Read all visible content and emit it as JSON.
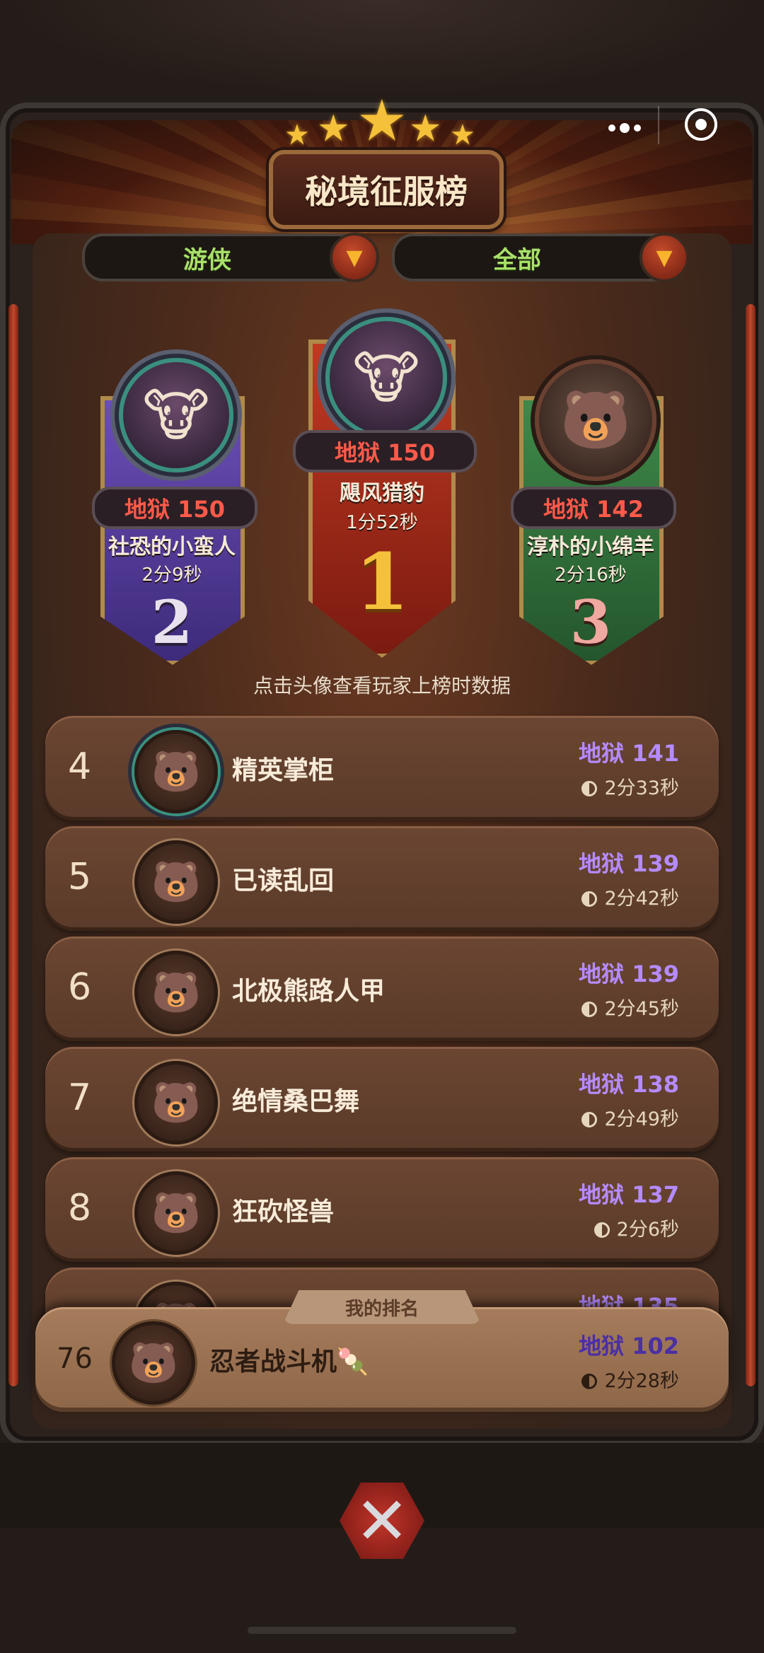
{
  "header": {
    "title": "秘境征服榜",
    "filter_class": "游侠",
    "filter_scope": "全部"
  },
  "podium": [
    {
      "rank": "1",
      "difficulty": "地狱 150",
      "name": "飓风猎豹",
      "time": "1分52秒"
    },
    {
      "rank": "2",
      "difficulty": "地狱 150",
      "name": "社恐的小蛮人",
      "time": "2分9秒"
    },
    {
      "rank": "3",
      "difficulty": "地狱 142",
      "name": "淳朴的小绵羊",
      "time": "2分16秒"
    }
  ],
  "hint": "点击头像查看玩家上榜时数据",
  "rows": [
    {
      "rank": "4",
      "name": "精英掌柜",
      "score": "地狱 141",
      "time": "2分33秒"
    },
    {
      "rank": "5",
      "name": "已读乱回",
      "score": "地狱 139",
      "time": "2分42秒"
    },
    {
      "rank": "6",
      "name": "北极熊路人甲",
      "score": "地狱 139",
      "time": "2分45秒"
    },
    {
      "rank": "7",
      "name": "绝情桑巴舞",
      "score": "地狱 138",
      "time": "2分49秒"
    },
    {
      "rank": "8",
      "name": "狂砍怪兽",
      "score": "地狱 137",
      "time": "2分6秒"
    },
    {
      "rank": "",
      "name": "",
      "score": "地狱 135",
      "time": ""
    }
  ],
  "my_rank": {
    "tab_label": "我的排名",
    "rank": "76",
    "name": "忍者战斗机🍡",
    "score": "地狱 102",
    "time": "2分28秒"
  },
  "icons": {
    "close": "close-x-icon",
    "dropdown": "chevron-down-icon",
    "more": "more-dots-icon",
    "target": "target-icon",
    "timer": "timer-icon"
  },
  "colors": {
    "score_purple": "#b58bff",
    "podium_score_red": "#ff5a4a",
    "filter_green": "#a9e06a",
    "gold_rank": "#f5c13a"
  }
}
